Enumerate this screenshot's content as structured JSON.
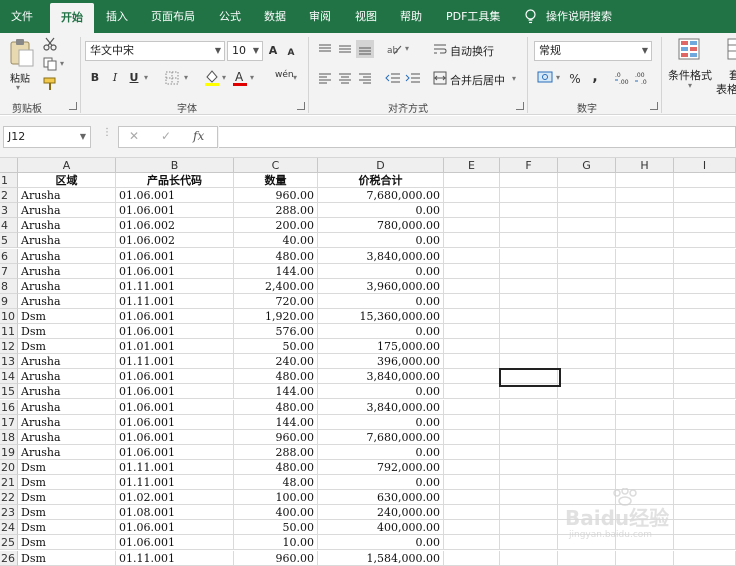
{
  "menu": {
    "tabs": [
      {
        "label": "文件"
      },
      {
        "label": "开始"
      },
      {
        "label": "插入"
      },
      {
        "label": "页面布局"
      },
      {
        "label": "公式"
      },
      {
        "label": "数据"
      },
      {
        "label": "审阅"
      },
      {
        "label": "视图"
      },
      {
        "label": "帮助"
      },
      {
        "label": "PDF工具集"
      }
    ],
    "active_tab": "开始",
    "tell_me": "操作说明搜索"
  },
  "ribbon": {
    "clipboard": {
      "paste": "粘贴",
      "label": "剪贴板"
    },
    "font": {
      "name": "华文中宋",
      "size": "10",
      "bold": "B",
      "italic": "I",
      "underline": "U",
      "increase_size": "A",
      "decrease_size": "A",
      "phonetic": "wén",
      "label": "字体"
    },
    "alignment": {
      "wrap_text": "自动换行",
      "merge_center": "合并后居中",
      "label": "对齐方式"
    },
    "number": {
      "format": "常规",
      "percent": "%",
      "comma": ",",
      "label": "数字"
    },
    "styles": {
      "conditional_format": "条件格式",
      "table_format_partial": "套",
      "table_format_partial2": "表格"
    }
  },
  "formula_bar": {
    "name_box": "J12",
    "fx": "fx",
    "cancel": "✕",
    "enter": "✓",
    "content": ""
  },
  "sheet": {
    "columns": [
      "A",
      "B",
      "C",
      "D",
      "E",
      "F",
      "G",
      "H",
      "I"
    ],
    "header_row": [
      "区域",
      "产品长代码",
      "数量",
      "价税合计"
    ],
    "rows": [
      [
        "Arusha",
        "01.06.001",
        "960.00",
        "7,680,000.00"
      ],
      [
        "Arusha",
        "01.06.001",
        "288.00",
        "0.00"
      ],
      [
        "Arusha",
        "01.06.002",
        "200.00",
        "780,000.00"
      ],
      [
        "Arusha",
        "01.06.002",
        "40.00",
        "0.00"
      ],
      [
        "Arusha",
        "01.06.001",
        "480.00",
        "3,840,000.00"
      ],
      [
        "Arusha",
        "01.06.001",
        "144.00",
        "0.00"
      ],
      [
        "Arusha",
        "01.11.001",
        "2,400.00",
        "3,960,000.00"
      ],
      [
        "Arusha",
        "01.11.001",
        "720.00",
        "0.00"
      ],
      [
        "Dsm",
        "01.06.001",
        "1,920.00",
        "15,360,000.00"
      ],
      [
        "Dsm",
        "01.06.001",
        "576.00",
        "0.00"
      ],
      [
        "Dsm",
        "01.01.001",
        "50.00",
        "175,000.00"
      ],
      [
        "Arusha",
        "01.11.001",
        "240.00",
        "396,000.00"
      ],
      [
        "Arusha",
        "01.06.001",
        "480.00",
        "3,840,000.00"
      ],
      [
        "Arusha",
        "01.06.001",
        "144.00",
        "0.00"
      ],
      [
        "Arusha",
        "01.06.001",
        "480.00",
        "3,840,000.00"
      ],
      [
        "Arusha",
        "01.06.001",
        "144.00",
        "0.00"
      ],
      [
        "Arusha",
        "01.06.001",
        "960.00",
        "7,680,000.00"
      ],
      [
        "Arusha",
        "01.06.001",
        "288.00",
        "0.00"
      ],
      [
        "Dsm",
        "01.11.001",
        "480.00",
        "792,000.00"
      ],
      [
        "Dsm",
        "01.11.001",
        "48.00",
        "0.00"
      ],
      [
        "Dsm",
        "01.02.001",
        "100.00",
        "630,000.00"
      ],
      [
        "Dsm",
        "01.08.001",
        "400.00",
        "240,000.00"
      ],
      [
        "Dsm",
        "01.06.001",
        "50.00",
        "400,000.00"
      ],
      [
        "Dsm",
        "01.06.001",
        "10.00",
        "0.00"
      ],
      [
        "Dsm",
        "01.11.001",
        "960.00",
        "1,584,000.00"
      ]
    ]
  },
  "watermark": {
    "brand": "Baidu经验",
    "url": "jingyan.baidu.com"
  },
  "colors": {
    "accent": "#217346",
    "selection": "#222222"
  }
}
